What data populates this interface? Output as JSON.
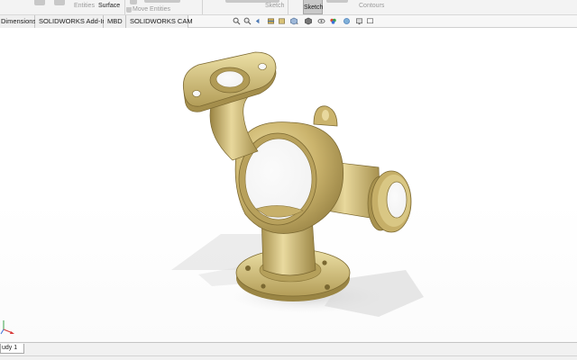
{
  "ribbon": {
    "entities_label": "Entities",
    "surface_label": "Surface",
    "sketch_label": "Sketch",
    "move_entities_label": "Move Entities",
    "sketch_button_label": "Sketch",
    "contours_label": "Contours"
  },
  "tabs": [
    {
      "label": "Dimensions"
    },
    {
      "label": "SOLIDWORKS Add-Ins"
    },
    {
      "label": "MBD"
    },
    {
      "label": "SOLIDWORKS CAM"
    }
  ],
  "hud_icons": [
    "search-icon",
    "zoom-to-area-icon",
    "previous-view-icon",
    "section-view-icon",
    "dynamic-annotation-icon",
    "view-orientation-icon",
    "display-style-icon",
    "hide-show-items-icon",
    "edit-appearance-icon",
    "apply-scene-icon",
    "view-settings-icon",
    "monitor-icon"
  ],
  "model": {
    "material_color": "#c8b36e",
    "shadow_color": "#d9d9d9"
  },
  "bottom_tabs": [
    {
      "label": "udy 1"
    }
  ],
  "colors": {
    "ribbon_bg": "#f3f3f3",
    "tab_bg": "#efefef",
    "viewport_bg": "#ffffff",
    "triad_x": "#d83a3a"
  }
}
